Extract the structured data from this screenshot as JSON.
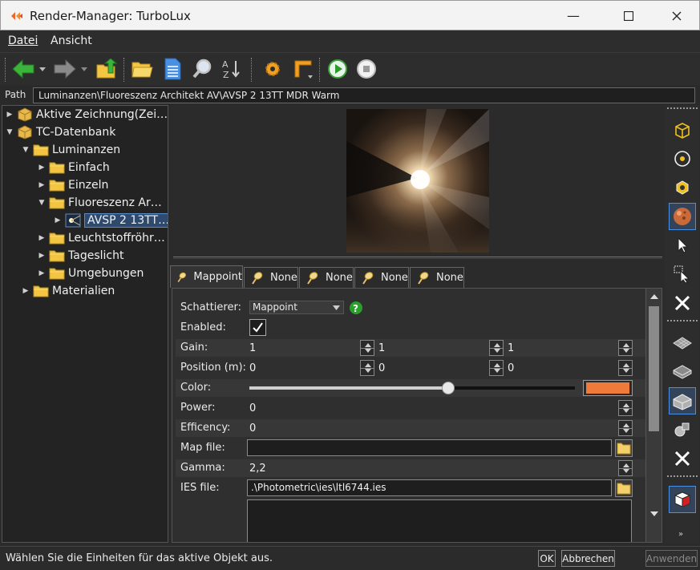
{
  "window": {
    "title": "Render-Manager: TurboLux"
  },
  "menu": {
    "items": [
      "Datei",
      "Ansicht"
    ]
  },
  "path": {
    "label": "Path",
    "value": "Luminanzen\\Fluoreszenz Architekt AV\\AVSP 2 13TT MDR Warm"
  },
  "tree": {
    "nodes": [
      {
        "label": "Aktive Zeichnung(Zei…",
        "expanded": false,
        "icon": "box-icon"
      },
      {
        "label": "TC-Datenbank",
        "expanded": true,
        "icon": "box-icon"
      },
      {
        "label": "Luminanzen",
        "expanded": true,
        "icon": "folder-icon"
      },
      {
        "label": "Einfach",
        "expanded": false,
        "icon": "folder-icon"
      },
      {
        "label": "Einzeln",
        "expanded": false,
        "icon": "folder-icon"
      },
      {
        "label": "Fluoreszenz Ar…",
        "expanded": true,
        "icon": "folder-icon"
      },
      {
        "label": "AVSP 2 13TT…",
        "expanded": false,
        "icon": "light-icon",
        "selected": true
      },
      {
        "label": "Leuchtstoffröhr…",
        "expanded": false,
        "icon": "folder-icon"
      },
      {
        "label": "Tageslicht",
        "expanded": false,
        "icon": "folder-icon"
      },
      {
        "label": "Umgebungen",
        "expanded": false,
        "icon": "folder-icon"
      },
      {
        "label": "Materialien",
        "expanded": false,
        "icon": "folder-icon"
      }
    ]
  },
  "tabs": [
    "Mappoint",
    "None",
    "None",
    "None",
    "None"
  ],
  "props": {
    "schattierer_label": "Schattierer:",
    "schattierer_value": "Mappoint",
    "enabled_label": "Enabled:",
    "gain_label": "Gain:",
    "gain_values": [
      "1",
      "1",
      "1"
    ],
    "position_label": "Position (m):",
    "position_values": [
      "0",
      "0",
      "0"
    ],
    "color_label": "Color:",
    "color_value": "#f07a3a",
    "color_slider": 0.61,
    "power_label": "Power:",
    "power_value": "0",
    "efficency_label": "Efficency:",
    "efficency_value": "0",
    "mapfile_label": "Map file:",
    "mapfile_value": "",
    "gamma_label": "Gamma:",
    "gamma_value": "2,2",
    "iesfile_label": "IES file:",
    "iesfile_value": ".\\Photometric\\ies\\ltl6744.ies"
  },
  "status": {
    "message": "Wählen Sie die Einheiten für das aktive Objekt aus.",
    "ok": "OK",
    "cancel": "Abbrechen",
    "apply": "Anwenden"
  }
}
